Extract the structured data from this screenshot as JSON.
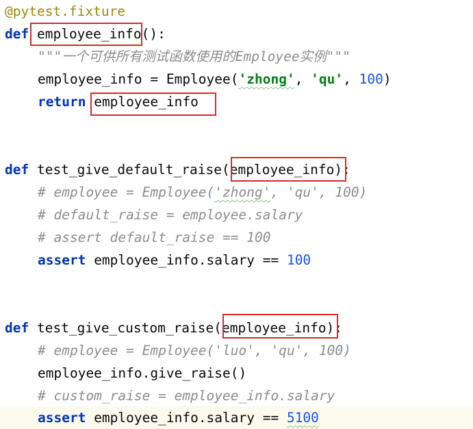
{
  "code": {
    "decorator": "@pytest.fixture",
    "kw_def": "def",
    "kw_return": "return",
    "kw_assert": "assert",
    "fixture": {
      "name": "employee_info",
      "params": "():",
      "docstring": "\"\"\"一个可供所有测试函数使用的Employee实例\"\"\"",
      "assign_lhs": "employee_info = Employee(",
      "arg1": "'zhong'",
      "sep": ", ",
      "arg2": "'qu'",
      "arg3": "100",
      "close": ")",
      "return_value": "employee_info"
    },
    "test_default": {
      "name": "test_give_default_raise",
      "open": "(",
      "param": "employee_info",
      "close": "):",
      "comment1_pre": "# employee = Employee(",
      "comment1_w": "'zhong'",
      "comment1_post": ", 'qu', 100)",
      "comment2": "# default_raise = employee.salary",
      "comment3": "# assert default_raise == 100",
      "assert_expr": " employee_info.salary == ",
      "assert_value": "100"
    },
    "test_custom": {
      "name": "test_give_custom_raise",
      "open": "(",
      "param": "employee_info",
      "close": "):",
      "comment1": "# employee = Employee('luo', 'qu', 100)",
      "call": "employee_info.give_raise()",
      "comment2": "# custom_raise = employee_info.salary",
      "assert_expr": " employee_info.salary == ",
      "assert_value": "5100"
    }
  },
  "colors": {
    "keyword": "#0033b3",
    "decorator": "#9e880d",
    "string": "#067d17",
    "number": "#1750eb",
    "comment": "#8c8c8c",
    "highlight_box": "#d42a2a",
    "current_line": "#fcfaed"
  }
}
